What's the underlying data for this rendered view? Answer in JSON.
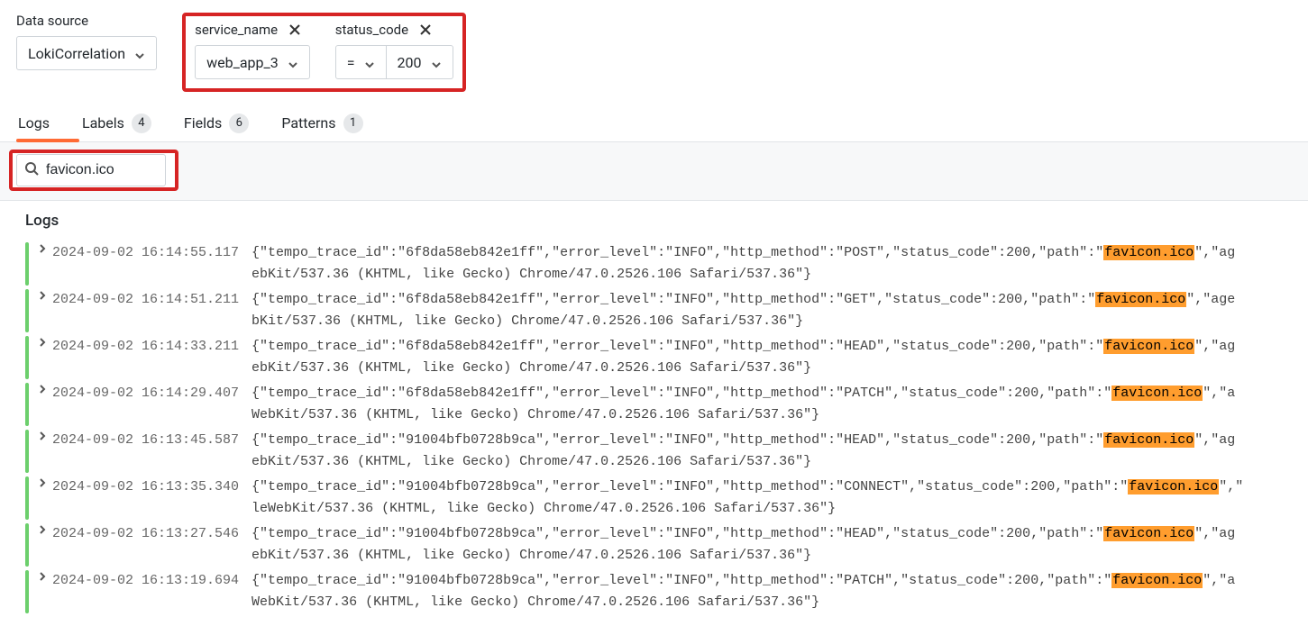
{
  "topbar": {
    "datasource_label": "Data source",
    "datasource_value": "LokiCorrelation",
    "filters": [
      {
        "label": "service_name",
        "value": "web_app_3",
        "op": null
      },
      {
        "label": "status_code",
        "op": "=",
        "value": "200"
      }
    ]
  },
  "tabs": [
    {
      "label": "Logs",
      "count": null,
      "active": true
    },
    {
      "label": "Labels",
      "count": "4",
      "active": false
    },
    {
      "label": "Fields",
      "count": "6",
      "active": false
    },
    {
      "label": "Patterns",
      "count": "1",
      "active": false
    }
  ],
  "search": {
    "value": "favicon.ico"
  },
  "logs_title": "Logs",
  "highlight": "favicon.ico",
  "logs": [
    {
      "ts": "2024-09-02 16:14:55.117",
      "line1_pre": "{\"tempo_trace_id\":\"6f8da58eb842e1ff\",\"error_level\":\"INFO\",\"http_method\":\"POST\",\"status_code\":200,\"path\":\"",
      "line1_post": "\",\"ag",
      "line2": "ebKit/537.36 (KHTML, like Gecko) Chrome/47.0.2526.106 Safari/537.36\"}"
    },
    {
      "ts": "2024-09-02 16:14:51.211",
      "line1_pre": "{\"tempo_trace_id\":\"6f8da58eb842e1ff\",\"error_level\":\"INFO\",\"http_method\":\"GET\",\"status_code\":200,\"path\":\"",
      "line1_post": "\",\"age",
      "line2": "bKit/537.36 (KHTML, like Gecko) Chrome/47.0.2526.106 Safari/537.36\"}"
    },
    {
      "ts": "2024-09-02 16:14:33.211",
      "line1_pre": "{\"tempo_trace_id\":\"6f8da58eb842e1ff\",\"error_level\":\"INFO\",\"http_method\":\"HEAD\",\"status_code\":200,\"path\":\"",
      "line1_post": "\",\"ag",
      "line2": "ebKit/537.36 (KHTML, like Gecko) Chrome/47.0.2526.106 Safari/537.36\"}"
    },
    {
      "ts": "2024-09-02 16:14:29.407",
      "line1_pre": "{\"tempo_trace_id\":\"6f8da58eb842e1ff\",\"error_level\":\"INFO\",\"http_method\":\"PATCH\",\"status_code\":200,\"path\":\"",
      "line1_post": "\",\"a",
      "line2": "WebKit/537.36 (KHTML, like Gecko) Chrome/47.0.2526.106 Safari/537.36\"}"
    },
    {
      "ts": "2024-09-02 16:13:45.587",
      "line1_pre": "{\"tempo_trace_id\":\"91004bfb0728b9ca\",\"error_level\":\"INFO\",\"http_method\":\"HEAD\",\"status_code\":200,\"path\":\"",
      "line1_post": "\",\"ag",
      "line2": "ebKit/537.36 (KHTML, like Gecko) Chrome/47.0.2526.106 Safari/537.36\"}"
    },
    {
      "ts": "2024-09-02 16:13:35.340",
      "line1_pre": "{\"tempo_trace_id\":\"91004bfb0728b9ca\",\"error_level\":\"INFO\",\"http_method\":\"CONNECT\",\"status_code\":200,\"path\":\"",
      "line1_post": "\",\"",
      "line2": "leWebKit/537.36 (KHTML, like Gecko) Chrome/47.0.2526.106 Safari/537.36\"}"
    },
    {
      "ts": "2024-09-02 16:13:27.546",
      "line1_pre": "{\"tempo_trace_id\":\"91004bfb0728b9ca\",\"error_level\":\"INFO\",\"http_method\":\"HEAD\",\"status_code\":200,\"path\":\"",
      "line1_post": "\",\"ag",
      "line2": "ebKit/537.36 (KHTML, like Gecko) Chrome/47.0.2526.106 Safari/537.36\"}"
    },
    {
      "ts": "2024-09-02 16:13:19.694",
      "line1_pre": "{\"tempo_trace_id\":\"91004bfb0728b9ca\",\"error_level\":\"INFO\",\"http_method\":\"PATCH\",\"status_code\":200,\"path\":\"",
      "line1_post": "\",\"a",
      "line2": "WebKit/537.36 (KHTML, like Gecko) Chrome/47.0.2526.106 Safari/537.36\"}"
    }
  ]
}
